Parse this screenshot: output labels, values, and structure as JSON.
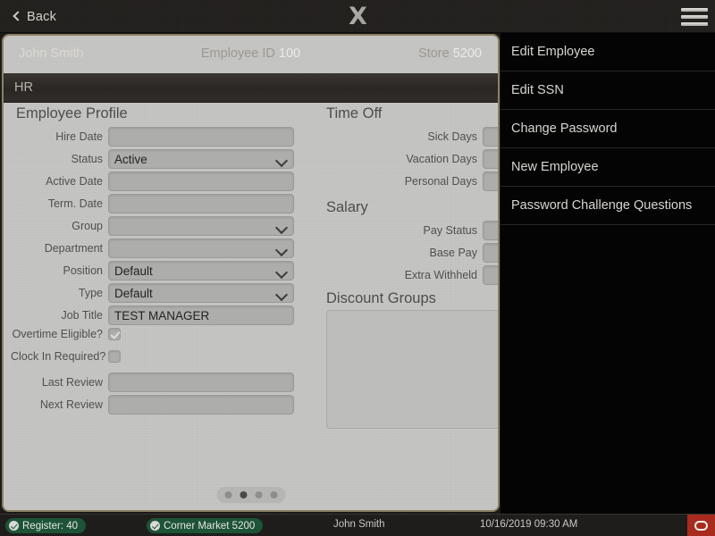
{
  "topbar": {
    "back_label": "Back",
    "logo_text": "X",
    "menu_icon": "hamburger-icon"
  },
  "employee_header": {
    "name": "John Smith",
    "employee_id_label": "Employee ID",
    "employee_id_value": "100",
    "store_label": "Store",
    "store_value": "5200"
  },
  "tabs": {
    "active_tab": "HR"
  },
  "sections": {
    "employee_profile": "Employee Profile",
    "time_off": "Time Off",
    "salary": "Salary",
    "discount_groups": "Discount Groups"
  },
  "profile_fields": [
    {
      "label": "Hire Date",
      "value": "",
      "type": "text"
    },
    {
      "label": "Status",
      "value": "Active",
      "type": "select"
    },
    {
      "label": "Active Date",
      "value": "",
      "type": "text"
    },
    {
      "label": "Term. Date",
      "value": "",
      "type": "text"
    },
    {
      "label": "Group",
      "value": "",
      "type": "select"
    },
    {
      "label": "Department",
      "value": "",
      "type": "select"
    },
    {
      "label": "Position",
      "value": "Default",
      "type": "select"
    },
    {
      "label": "Type",
      "value": "Default",
      "type": "select"
    },
    {
      "label": "Job Title",
      "value": "TEST MANAGER",
      "type": "text"
    },
    {
      "label": "Overtime Eligible?",
      "value": "checked",
      "type": "checkbox"
    },
    {
      "label": "Clock In Required?",
      "value": "unchecked",
      "type": "checkbox"
    },
    {
      "label": "Last Review",
      "value": "",
      "type": "text"
    },
    {
      "label": "Next Review",
      "value": "",
      "type": "text"
    }
  ],
  "time_off_fields": [
    {
      "label": "Sick Days",
      "value": ""
    },
    {
      "label": "Vacation Days",
      "value": ""
    },
    {
      "label": "Personal Days",
      "value": ""
    }
  ],
  "salary_fields": [
    {
      "label": "Pay Status",
      "value": ""
    },
    {
      "label": "Base Pay",
      "value": ""
    },
    {
      "label": "Extra Withheld",
      "value": ""
    }
  ],
  "discount_groups_items": [],
  "pager": {
    "total": 4,
    "active_index": 1
  },
  "side_menu": {
    "items": [
      {
        "label": "Edit Employee"
      },
      {
        "label": "Edit SSN"
      },
      {
        "label": "Change Password"
      },
      {
        "label": "New Employee"
      },
      {
        "label": "Password Challenge Questions"
      }
    ]
  },
  "statusbar": {
    "register_badge": "Register: 40",
    "store_badge": "Corner Market 5200",
    "user": "John Smith",
    "datetime": "10/16/2019 09:30 AM",
    "stop_icon": "stop-oval-icon"
  },
  "colors": {
    "accent_green": "#1d5336",
    "accent_red": "#a82b1d",
    "card_border": "#8a8165",
    "form_bg": "#c5c5c3",
    "menu_bg": "#040404"
  }
}
